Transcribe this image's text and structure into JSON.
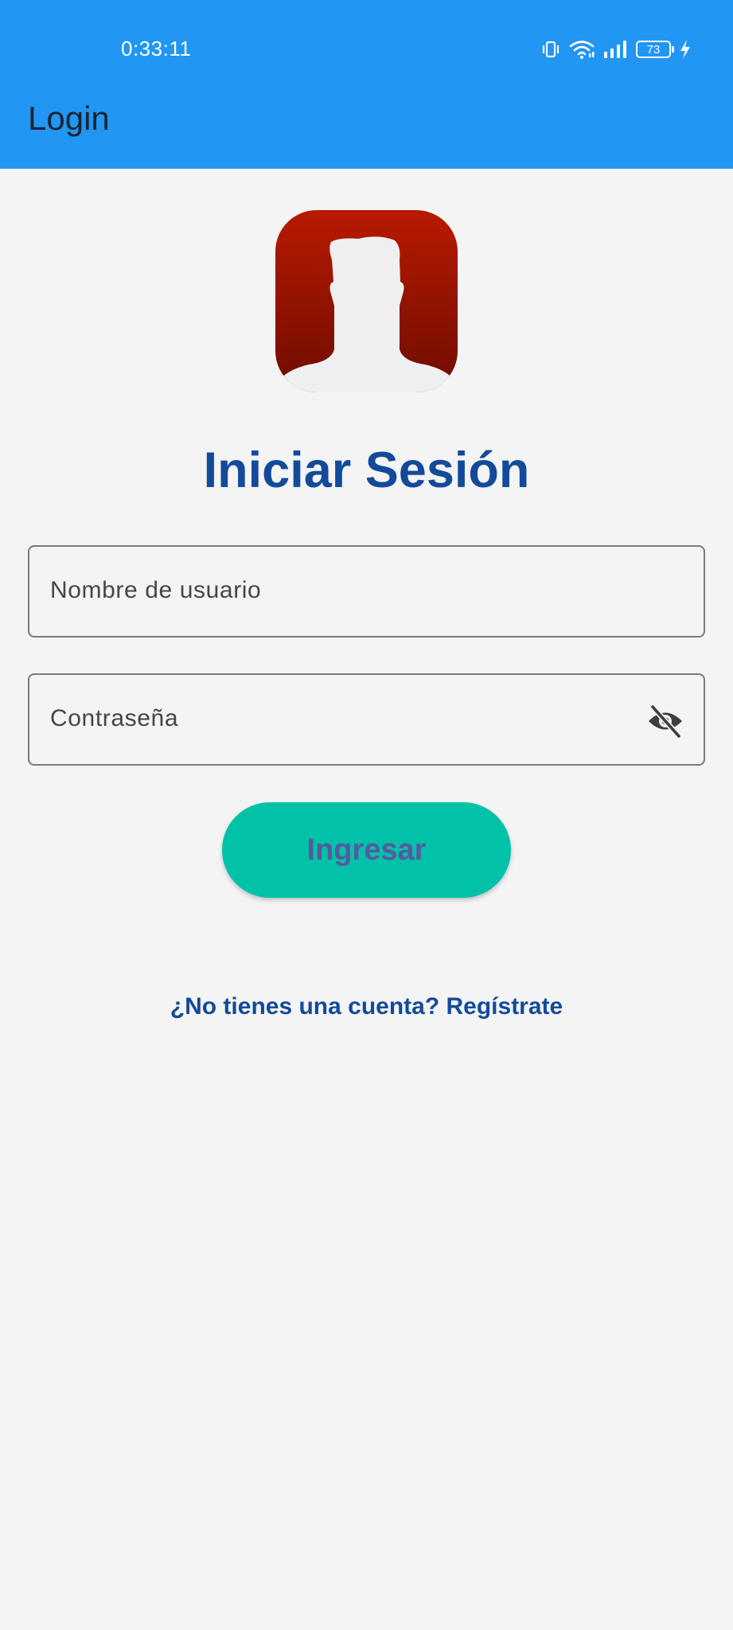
{
  "status_bar": {
    "time": "0:33:11",
    "battery_level": "73",
    "icons": [
      "vibrate-icon",
      "wifi-icon",
      "signal-icon",
      "battery-icon",
      "charging-icon"
    ]
  },
  "app_bar": {
    "title": "Login",
    "color": "#2196f3"
  },
  "login": {
    "avatar_icon": "user-avatar-icon",
    "title": "Iniciar Sesión",
    "username_placeholder": "Nombre de usuario",
    "password_placeholder": "Contraseña",
    "password_toggle_icon": "eye-off-icon",
    "submit_label": "Ingresar",
    "register_link": "¿No tienes una cuenta? Regístrate"
  },
  "colors": {
    "accent": "#134a9a",
    "button": "#00c2a8",
    "avatar_top": "#b81a00",
    "avatar_bottom": "#6e0c00"
  }
}
